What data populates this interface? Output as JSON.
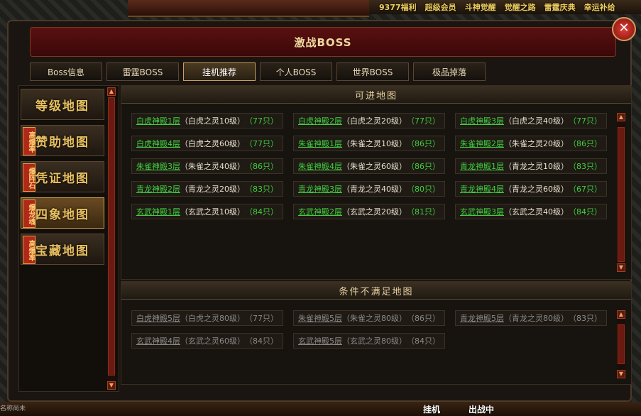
{
  "top_menu": [
    "9377福利",
    "超级会员",
    "斗神觉醒",
    "觉醒之路",
    "雷霆庆典",
    "幸运补给"
  ],
  "dialog": {
    "title": "激战BOSS",
    "close": "✕",
    "tabs": [
      "Boss信息",
      "雷霆BOSS",
      "挂机推荐",
      "个人BOSS",
      "世界BOSS",
      "极品掉落"
    ],
    "active_tab": 2
  },
  "left_menu": [
    {
      "label": "等级地图",
      "tag": ""
    },
    {
      "label": "赞助地图",
      "tag": "高爆率"
    },
    {
      "label": "凭证地图",
      "tag": "爆阵石"
    },
    {
      "label": "四象地图",
      "tag": "爆龙魂"
    },
    {
      "label": "宝藏地图",
      "tag": "高爆率"
    }
  ],
  "left_active": 3,
  "available": {
    "heading": "可进地图",
    "maps": [
      {
        "name": "白虎神殿1层",
        "boss": "（白虎之灵10级）",
        "count": "（77只）"
      },
      {
        "name": "白虎神殿2层",
        "boss": "（白虎之灵20级）",
        "count": "（77只）"
      },
      {
        "name": "白虎神殿3层",
        "boss": "（白虎之灵40级）",
        "count": "（77只）"
      },
      {
        "name": "白虎神殿4层",
        "boss": "（白虎之灵60级）",
        "count": "（77只）"
      },
      {
        "name": "朱雀神殿1层",
        "boss": "（朱雀之灵10级）",
        "count": "（86只）"
      },
      {
        "name": "朱雀神殿2层",
        "boss": "（朱雀之灵20级）",
        "count": "（86只）"
      },
      {
        "name": "朱雀神殿3层",
        "boss": "（朱雀之灵40级）",
        "count": "（86只）"
      },
      {
        "name": "朱雀神殿4层",
        "boss": "（朱雀之灵60级）",
        "count": "（86只）"
      },
      {
        "name": "青龙神殿1层",
        "boss": "（青龙之灵10级）",
        "count": "（83只）"
      },
      {
        "name": "青龙神殿2层",
        "boss": "（青龙之灵20级）",
        "count": "（83只）"
      },
      {
        "name": "青龙神殿3层",
        "boss": "（青龙之灵40级）",
        "count": "（80只）"
      },
      {
        "name": "青龙神殿4层",
        "boss": "（青龙之灵60级）",
        "count": "（67只）"
      },
      {
        "name": "玄武神殿1层",
        "boss": "（玄武之灵10级）",
        "count": "（84只）"
      },
      {
        "name": "玄武神殿2层",
        "boss": "（玄武之灵20级）",
        "count": "（81只）"
      },
      {
        "name": "玄武神殿3层",
        "boss": "（玄武之灵40级）",
        "count": "（84只）"
      }
    ]
  },
  "unavailable": {
    "heading": "条件不满足地图",
    "maps": [
      {
        "name": "白虎神殿5层",
        "boss": "（白虎之灵80级）",
        "count": "（77只）"
      },
      {
        "name": "朱雀神殿5层",
        "boss": "（朱雀之灵80级）",
        "count": "（86只）"
      },
      {
        "name": "青龙神殿5层",
        "boss": "（青龙之灵80级）",
        "count": "（83只）"
      },
      {
        "name": "玄武神殿4层",
        "boss": "（玄武之灵60级）",
        "count": "（84只）"
      },
      {
        "name": "玄武神殿5层",
        "boss": "（玄武之灵80级）",
        "count": "（84只）"
      }
    ]
  },
  "bottom": {
    "hang": "挂机",
    "fight": "出战中",
    "corner": "名称尚未"
  }
}
